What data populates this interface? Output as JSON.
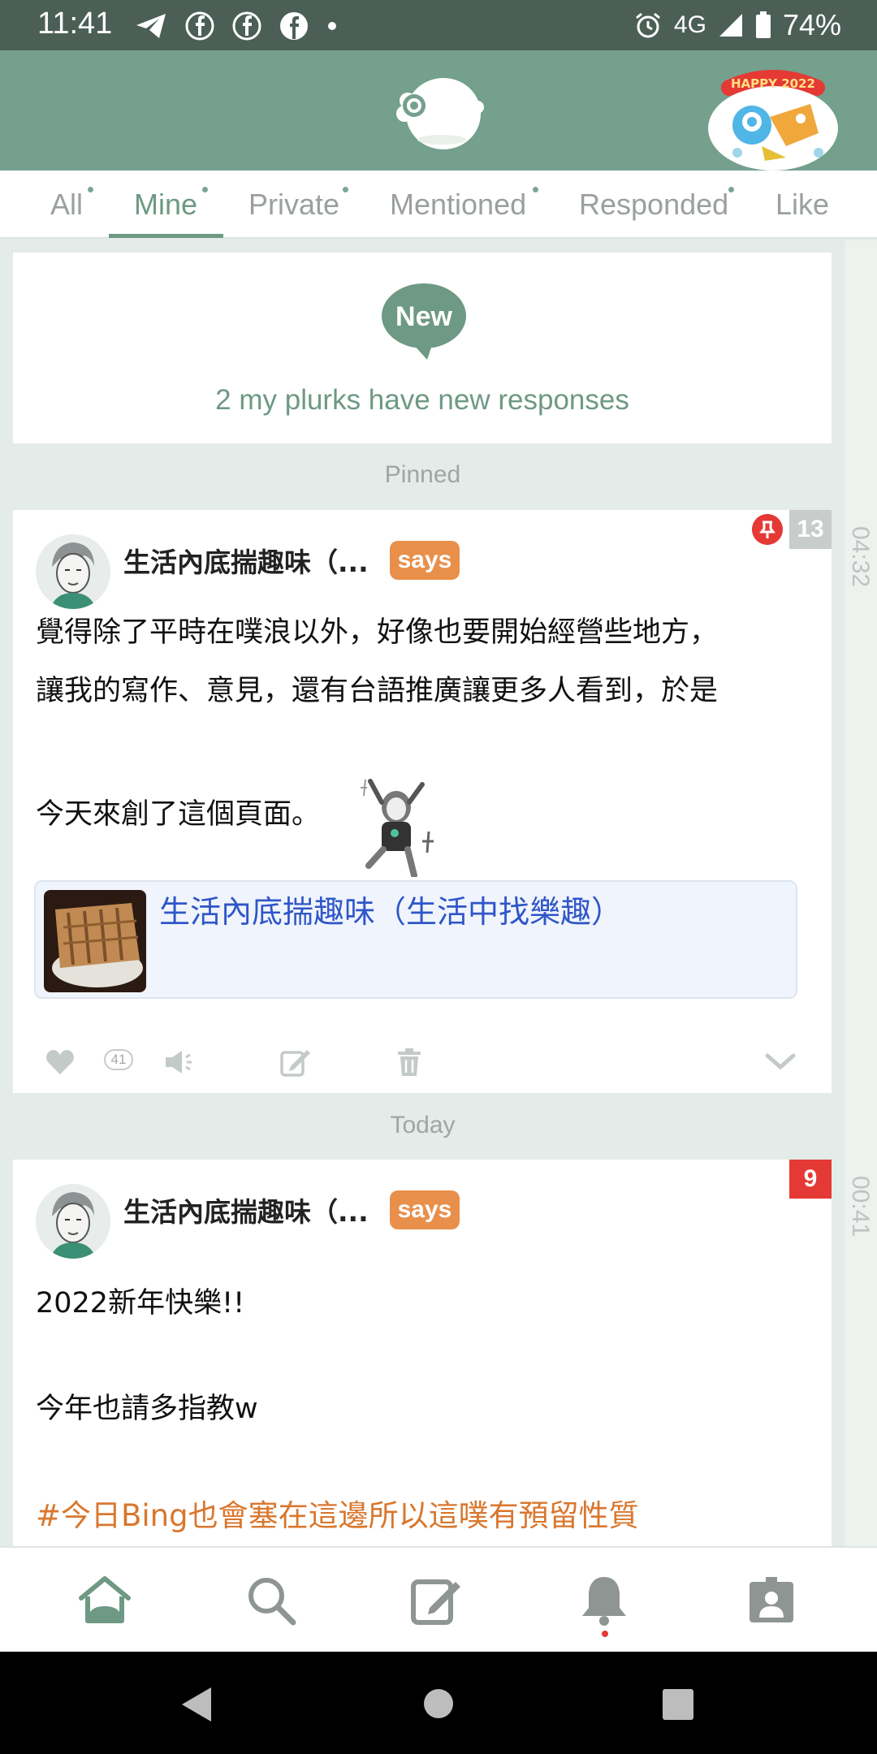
{
  "status_bar": {
    "time": "11:41",
    "network": "4G",
    "battery": "74%",
    "left_icons": [
      "telegram-icon",
      "facebook-icon",
      "facebook-icon",
      "facebook-icon",
      "dot-icon"
    ],
    "right_icons": [
      "alarm-icon",
      "signal-icon",
      "battery-icon"
    ]
  },
  "header": {
    "badge_text": "HAPPY 2022"
  },
  "tabs": [
    {
      "label": "All",
      "active": false
    },
    {
      "label": "Mine",
      "active": true
    },
    {
      "label": "Private",
      "active": false
    },
    {
      "label": "Mentioned",
      "active": false
    },
    {
      "label": "Responded",
      "active": false
    },
    {
      "label": "Like",
      "active": false
    }
  ],
  "new_responses": {
    "bubble": "New",
    "message": "2 my plurks have new responses"
  },
  "sections": {
    "pinned": "Pinned",
    "today": "Today"
  },
  "plurks": [
    {
      "author": "生活內底揣趣味（...",
      "qualifier": "says",
      "response_count": "13",
      "time": "04:32",
      "lines": [
        "覺得除了平時在噗浪以外，好像也要開始經營些地方，",
        "讓我的寫作、意見，還有台語推廣讓更多人看到，於是",
        "今天來創了這個頁面。"
      ],
      "link_title": "生活內底揣趣味（生活中找樂趣）",
      "likes": "41"
    },
    {
      "author": "生活內底揣趣味（...",
      "qualifier": "says",
      "response_count": "9",
      "time": "00:41",
      "lines": [
        "2022新年快樂!!",
        "今年也請多指教w"
      ],
      "hashtag": "#今日Bing也會塞在這邊所以這噗有預留性質"
    }
  ],
  "colors": {
    "header": "#74a08d",
    "accent": "#6e9984",
    "says": "#e8904b",
    "badge_red": "#e53935",
    "badge_gray": "#c8cccb",
    "link": "#2f56c8",
    "hashtag": "#d9772e"
  },
  "bottom_nav": [
    {
      "name": "home-icon",
      "active": true
    },
    {
      "name": "search-icon",
      "active": false
    },
    {
      "name": "compose-icon",
      "active": false
    },
    {
      "name": "bell-icon",
      "active": false,
      "has_dot": true
    },
    {
      "name": "profile-icon",
      "active": false
    }
  ]
}
